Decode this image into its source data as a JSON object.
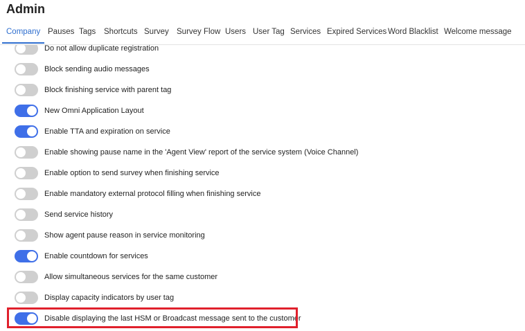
{
  "header": {
    "title": "Admin"
  },
  "tabs": [
    {
      "label": "Company",
      "active": true
    },
    {
      "label": "Pauses",
      "active": false
    },
    {
      "label": "Tags",
      "active": false
    },
    {
      "label": "Shortcuts",
      "active": false
    },
    {
      "label": "Survey",
      "active": false
    },
    {
      "label": "Survey Flow",
      "active": false
    },
    {
      "label": "Users",
      "active": false
    },
    {
      "label": "User Tag",
      "active": false
    },
    {
      "label": "Services",
      "active": false
    },
    {
      "label": "Expired Services",
      "active": false
    },
    {
      "label": "Word Blacklist",
      "active": false
    },
    {
      "label": "Welcome message",
      "active": false
    }
  ],
  "settings": [
    {
      "label": "Do not allow duplicate registration",
      "enabled": false
    },
    {
      "label": "Block sending audio messages",
      "enabled": false
    },
    {
      "label": "Block finishing service with parent tag",
      "enabled": false
    },
    {
      "label": "New Omni Application Layout",
      "enabled": true
    },
    {
      "label": "Enable TTA and expiration on service",
      "enabled": true
    },
    {
      "label": "Enable showing pause name in the 'Agent View' report of the service system (Voice Channel)",
      "enabled": false
    },
    {
      "label": "Enable option to send survey when finishing service",
      "enabled": false
    },
    {
      "label": "Enable mandatory external protocol filling when finishing service",
      "enabled": false
    },
    {
      "label": "Send service history",
      "enabled": false
    },
    {
      "label": "Show agent pause reason in service monitoring",
      "enabled": false
    },
    {
      "label": "Enable countdown for services",
      "enabled": true
    },
    {
      "label": "Allow simultaneous services for the same customer",
      "enabled": false
    },
    {
      "label": "Display capacity indicators by user tag",
      "enabled": false
    },
    {
      "label": "Disable displaying the last HSM or Broadcast message sent to the customer",
      "enabled": true
    }
  ],
  "highlighted_setting_index": 13,
  "colors": {
    "accent": "#2f6fcf",
    "toggle_on": "#3f6fe8",
    "toggle_off": "#cfcfcf",
    "highlight": "#e0202c"
  }
}
